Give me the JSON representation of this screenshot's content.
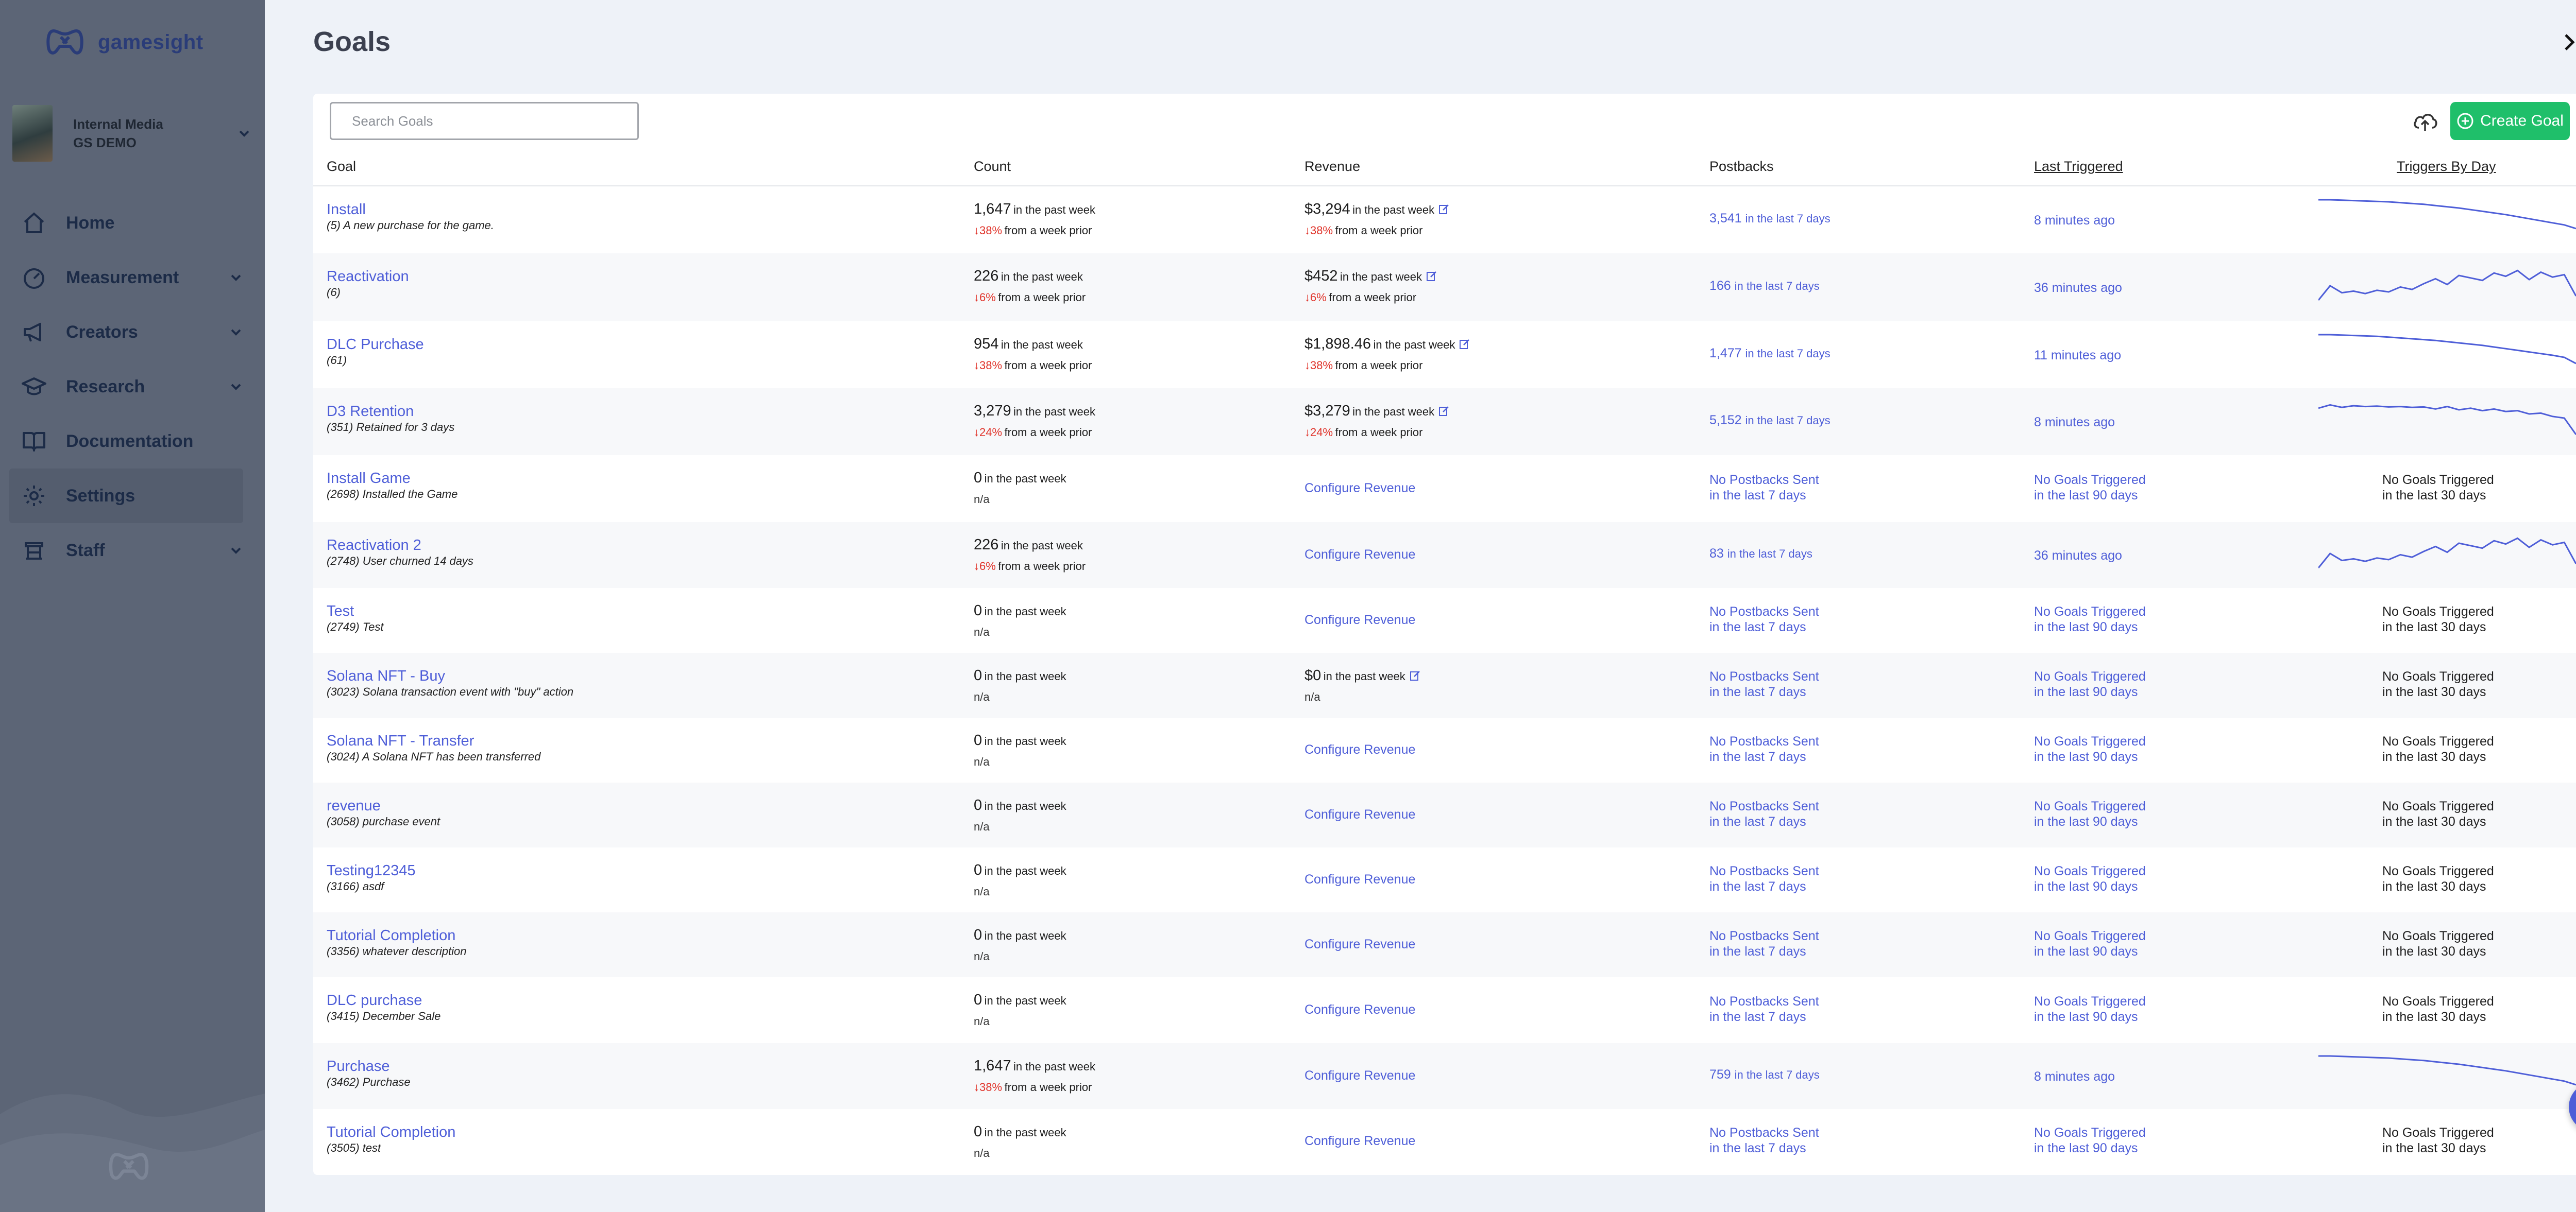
{
  "brand": {
    "name": "gamesight"
  },
  "org": {
    "line1": "Internal Media",
    "line2": "GS DEMO"
  },
  "nav": [
    {
      "label": "Home",
      "icon": "home-icon",
      "chevron": false
    },
    {
      "label": "Measurement",
      "icon": "gauge-icon",
      "chevron": true
    },
    {
      "label": "Creators",
      "icon": "megaphone-icon",
      "chevron": true
    },
    {
      "label": "Research",
      "icon": "graduation-cap-icon",
      "chevron": true
    },
    {
      "label": "Documentation",
      "icon": "book-icon",
      "chevron": false
    },
    {
      "label": "Settings",
      "icon": "gear-icon",
      "chevron": false,
      "active": true
    },
    {
      "label": "Staff",
      "icon": "staff-icon",
      "chevron": true
    }
  ],
  "panel": {
    "title": "Goals"
  },
  "search": {
    "placeholder": "Search Goals"
  },
  "toolbar": {
    "create_label": "Create Goal"
  },
  "columns": {
    "goal": "Goal",
    "count": "Count",
    "revenue": "Revenue",
    "postbacks": "Postbacks",
    "last_triggered": "Last Triggered",
    "triggers_by_day": "Triggers By Day"
  },
  "colors": {
    "accent": "#4e5ed8",
    "create": "#1fbf6a",
    "negative": "#e0352c"
  },
  "rows": [
    {
      "name": "Install",
      "desc": "(5) A new purchase for the game.",
      "count": "1,647",
      "count_suffix": "in the past week",
      "count_change": "38%",
      "count_change_suffix": "from a week prior",
      "revenue": "$3,294",
      "revenue_suffix": "in the past week",
      "revenue_change": "38%",
      "revenue_change_suffix": "from a week prior",
      "postbacks": "3,541",
      "postbacks_suffix": "in the last 7 days",
      "last_triggered": "8 minutes ago",
      "spark": [
        100,
        100,
        99,
        98,
        97,
        96,
        95,
        93,
        91,
        89,
        86,
        83,
        80,
        76,
        72,
        68,
        64,
        59,
        54,
        49,
        44,
        39,
        30
      ]
    },
    {
      "name": "Reactivation",
      "desc": "(6)",
      "count": "226",
      "count_suffix": "in the past week",
      "count_change": "6%",
      "count_change_suffix": "from a week prior",
      "revenue": "$452",
      "revenue_suffix": "in the past week",
      "revenue_change": "6%",
      "revenue_change_suffix": "from a week prior",
      "postbacks": "166",
      "postbacks_suffix": "in the last 7 days",
      "last_triggered": "36 minutes ago",
      "spark": [
        20,
        55,
        38,
        42,
        36,
        44,
        40,
        52,
        46,
        60,
        72,
        58,
        80,
        74,
        68,
        86,
        78,
        92,
        70,
        88,
        76,
        82,
        30
      ]
    },
    {
      "name": "DLC Purchase",
      "desc": "(61)",
      "count": "954",
      "count_suffix": "in the past week",
      "count_change": "38%",
      "count_change_suffix": "from a week prior",
      "revenue": "$1,898.46",
      "revenue_suffix": "in the past week",
      "revenue_change": "38%",
      "revenue_change_suffix": "from a week prior",
      "postbacks": "1,477",
      "postbacks_suffix": "in the last 7 days",
      "last_triggered": "11 minutes ago",
      "spark": [
        100,
        100,
        99,
        98,
        97,
        96,
        94,
        92,
        90,
        88,
        86,
        83,
        80,
        77,
        74,
        70,
        66,
        62,
        58,
        54,
        50,
        45,
        30
      ]
    },
    {
      "name": "D3 Retention",
      "desc": "(351) Retained for 3 days",
      "count": "3,279",
      "count_suffix": "in the past week",
      "count_change": "24%",
      "count_change_suffix": "from a week prior",
      "revenue": "$3,279",
      "revenue_suffix": "in the past week",
      "revenue_change": "24%",
      "revenue_change_suffix": "from a week prior",
      "postbacks": "5,152",
      "postbacks_suffix": "in the last 7 days",
      "last_triggered": "8 minutes ago",
      "spark": [
        84,
        92,
        86,
        90,
        88,
        89,
        87,
        88,
        86,
        87,
        82,
        88,
        80,
        84,
        78,
        82,
        76,
        78,
        70,
        72,
        64,
        60,
        20
      ]
    },
    {
      "name": "Install Game",
      "desc": "(2698) Installed the Game",
      "count": "0",
      "count_suffix": "in the past week",
      "count_change": "",
      "count_na": "n/a",
      "revenue_link": "Configure Revenue",
      "postbacks_none": [
        "No Postbacks Sent",
        "in the last 7 days"
      ],
      "triggered_none": [
        "No Goals Triggered",
        "in the last 90 days"
      ],
      "tbd_none": [
        "No Goals Triggered",
        "in the last 30 days"
      ]
    },
    {
      "name": "Reactivation 2",
      "desc": "(2748) User churned 14 days",
      "count": "226",
      "count_suffix": "in the past week",
      "count_change": "6%",
      "count_change_suffix": "from a week prior",
      "revenue_link": "Configure Revenue",
      "postbacks": "83",
      "postbacks_suffix": "in the last 7 days",
      "last_triggered": "36 minutes ago",
      "spark": [
        20,
        55,
        38,
        42,
        36,
        44,
        40,
        52,
        46,
        60,
        72,
        58,
        80,
        74,
        68,
        86,
        78,
        92,
        70,
        88,
        76,
        82,
        30
      ]
    },
    {
      "name": "Test",
      "desc": "(2749) Test",
      "count": "0",
      "count_suffix": "in the past week",
      "count_na": "n/a",
      "revenue_link": "Configure Revenue",
      "postbacks_none": [
        "No Postbacks Sent",
        "in the last 7 days"
      ],
      "triggered_none": [
        "No Goals Triggered",
        "in the last 90 days"
      ],
      "tbd_none": [
        "No Goals Triggered",
        "in the last 30 days"
      ]
    },
    {
      "name": "Solana NFT - Buy",
      "desc": "(3023) Solana transaction event with \"buy\" action",
      "count": "0",
      "count_suffix": "in the past week",
      "count_na": "n/a",
      "revenue": "$0",
      "revenue_suffix": "in the past week",
      "revenue_na": "n/a",
      "postbacks_none": [
        "No Postbacks Sent",
        "in the last 7 days"
      ],
      "triggered_none": [
        "No Goals Triggered",
        "in the last 90 days"
      ],
      "tbd_none": [
        "No Goals Triggered",
        "in the last 30 days"
      ]
    },
    {
      "name": "Solana NFT - Transfer",
      "desc": "(3024) A Solana NFT has been transferred",
      "count": "0",
      "count_suffix": "in the past week",
      "count_na": "n/a",
      "revenue_link": "Configure Revenue",
      "postbacks_none": [
        "No Postbacks Sent",
        "in the last 7 days"
      ],
      "triggered_none": [
        "No Goals Triggered",
        "in the last 90 days"
      ],
      "tbd_none": [
        "No Goals Triggered",
        "in the last 30 days"
      ]
    },
    {
      "name": "revenue",
      "desc": "(3058) purchase event",
      "count": "0",
      "count_suffix": "in the past week",
      "count_na": "n/a",
      "revenue_link": "Configure Revenue",
      "postbacks_none": [
        "No Postbacks Sent",
        "in the last 7 days"
      ],
      "triggered_none": [
        "No Goals Triggered",
        "in the last 90 days"
      ],
      "tbd_none": [
        "No Goals Triggered",
        "in the last 30 days"
      ]
    },
    {
      "name": "Testing12345",
      "desc": "(3166) asdf",
      "count": "0",
      "count_suffix": "in the past week",
      "count_na": "n/a",
      "revenue_link": "Configure Revenue",
      "postbacks_none": [
        "No Postbacks Sent",
        "in the last 7 days"
      ],
      "triggered_none": [
        "No Goals Triggered",
        "in the last 90 days"
      ],
      "tbd_none": [
        "No Goals Triggered",
        "in the last 30 days"
      ]
    },
    {
      "name": "Tutorial Completion",
      "desc": "(3356) whatever description",
      "count": "0",
      "count_suffix": "in the past week",
      "count_na": "n/a",
      "revenue_link": "Configure Revenue",
      "postbacks_none": [
        "No Postbacks Sent",
        "in the last 7 days"
      ],
      "triggered_none": [
        "No Goals Triggered",
        "in the last 90 days"
      ],
      "tbd_none": [
        "No Goals Triggered",
        "in the last 30 days"
      ]
    },
    {
      "name": "DLC purchase",
      "desc": "(3415) December Sale",
      "count": "0",
      "count_suffix": "in the past week",
      "count_na": "n/a",
      "revenue_link": "Configure Revenue",
      "postbacks_none": [
        "No Postbacks Sent",
        "in the last 7 days"
      ],
      "triggered_none": [
        "No Goals Triggered",
        "in the last 90 days"
      ],
      "tbd_none": [
        "No Goals Triggered",
        "in the last 30 days"
      ]
    },
    {
      "name": "Purchase",
      "desc": "(3462) Purchase",
      "count": "1,647",
      "count_suffix": "in the past week",
      "count_change": "38%",
      "count_change_suffix": "from a week prior",
      "revenue_link": "Configure Revenue",
      "postbacks": "759",
      "postbacks_suffix": "in the last 7 days",
      "last_triggered": "8 minutes ago",
      "spark": [
        100,
        100,
        99,
        98,
        97,
        96,
        95,
        93,
        91,
        89,
        86,
        83,
        80,
        76,
        72,
        68,
        64,
        59,
        54,
        49,
        44,
        39,
        30
      ]
    },
    {
      "name": "Tutorial Completion",
      "desc": "(3505) test",
      "count": "0",
      "count_suffix": "in the past week",
      "count_na": "n/a",
      "revenue_link": "Configure Revenue",
      "postbacks_none": [
        "No Postbacks Sent",
        "in the last 7 days"
      ],
      "triggered_none": [
        "No Goals Triggered",
        "in the last 90 days"
      ],
      "tbd_none": [
        "No Goals Triggered",
        "in the last 30 days"
      ]
    }
  ]
}
